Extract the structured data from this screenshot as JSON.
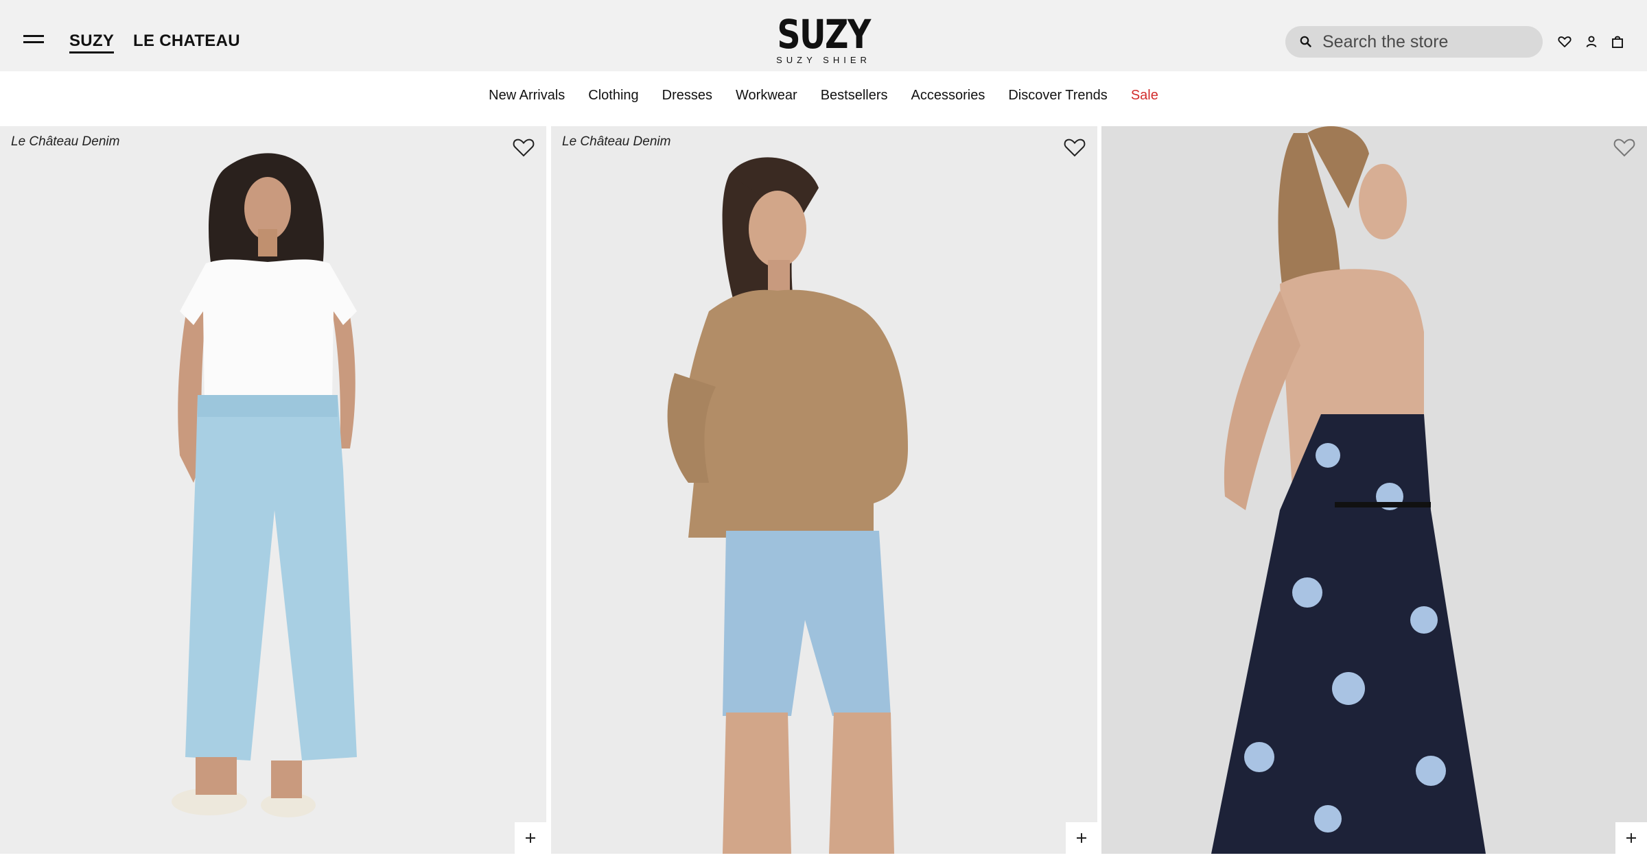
{
  "header": {
    "menu_icon": "hamburger-menu-icon",
    "brand_tabs": [
      "SUZY",
      "LE CHATEAU"
    ],
    "active_brand": "SUZY",
    "logo": {
      "main": "SUZY",
      "sub": "SUZY SHIER"
    },
    "search": {
      "placeholder": "Search the store",
      "value": "",
      "icon": "search-icon"
    },
    "icons": [
      "heart-icon",
      "account-icon",
      "shopping-bag-icon"
    ]
  },
  "nav": {
    "items": [
      "New Arrivals",
      "Clothing",
      "Dresses",
      "Workwear",
      "Bestsellers",
      "Accessories",
      "Discover Trends",
      "Sale"
    ],
    "sale_color": "#d22c2c"
  },
  "products": [
    {
      "label": "Le Château Denim",
      "image": "model in white tee and light blue wide-leg pants",
      "icons": [
        "heart-outline-icon",
        "plus-icon"
      ]
    },
    {
      "label": "Le Château Denim",
      "image": "model in tan tie-neck blouse and denim shorts",
      "icons": [
        "heart-outline-icon",
        "plus-icon"
      ]
    },
    {
      "label": "",
      "image": "model in navy floral slip dress, back view",
      "icons": [
        "heart-outline-icon",
        "plus-icon"
      ]
    }
  ],
  "colors": {
    "topbar_bg": "#f1f1f1",
    "search_bg": "#d9d9d9",
    "text": "#111111"
  }
}
